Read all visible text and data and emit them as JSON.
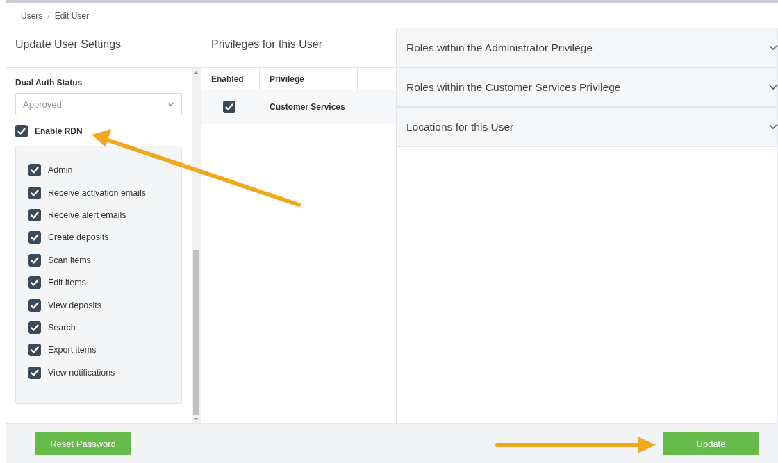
{
  "breadcrumb": {
    "items": [
      {
        "label": "Users"
      },
      {
        "label": "Edit User"
      }
    ],
    "separator": "/"
  },
  "settings": {
    "title": "Update User Settings",
    "dual_auth": {
      "label": "Dual Auth Status",
      "value": "Approved",
      "disabled": true
    },
    "enable_rdn": {
      "label": "Enable RDN",
      "checked": true
    },
    "permissions": [
      {
        "label": "Admin",
        "checked": true
      },
      {
        "label": "Receive activation emails",
        "checked": true
      },
      {
        "label": "Receive alert emails",
        "checked": true
      },
      {
        "label": "Create deposits",
        "checked": true
      },
      {
        "label": "Scan items",
        "checked": true
      },
      {
        "label": "Edit items",
        "checked": true
      },
      {
        "label": "View deposits",
        "checked": true
      },
      {
        "label": "Search",
        "checked": true
      },
      {
        "label": "Export items",
        "checked": true
      },
      {
        "label": "View notifications",
        "checked": true
      }
    ]
  },
  "privileges": {
    "title": "Privileges for this User",
    "columns": [
      "Enabled",
      "Privilege"
    ],
    "rows": [
      {
        "enabled": true,
        "privilege": "Customer Services"
      }
    ]
  },
  "accordions": [
    {
      "title": "Roles within the Administrator Privilege",
      "expanded": false
    },
    {
      "title": "Roles within the Customer Services Privilege",
      "expanded": false
    },
    {
      "title": "Locations for this User",
      "expanded": false
    }
  ],
  "footer": {
    "buttons": [
      {
        "label": "Reset Password"
      },
      {
        "label": "Update"
      }
    ]
  }
}
